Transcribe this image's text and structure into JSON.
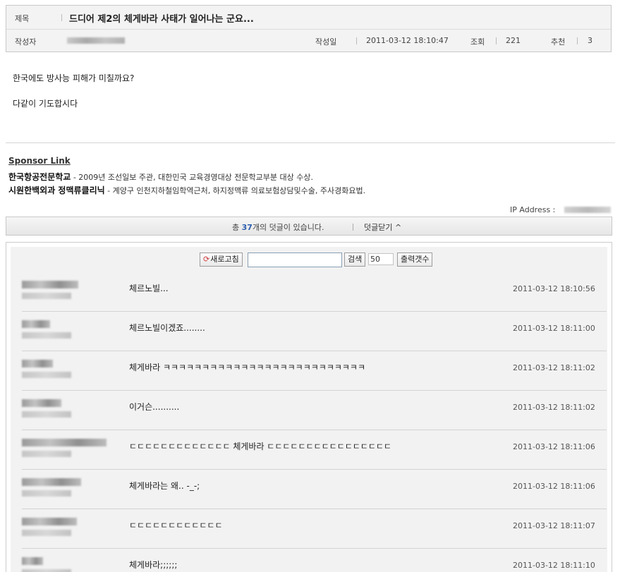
{
  "post": {
    "title_label": "제목",
    "title": "드디어 제2의 체게바라 사태가 일어나는 군요...",
    "author_label": "작성자",
    "date_label": "작성일",
    "date": "2011-03-12 18:10:47",
    "views_label": "조회",
    "views": "221",
    "recommend_label": "추천",
    "recommend": "3",
    "body_lines": [
      "한국에도 방사능 피해가 미칠까요?",
      "다같이 기도합시다"
    ]
  },
  "sponsor": {
    "title": "Sponsor Link",
    "items": [
      {
        "name": "한국항공전문학교",
        "desc": " - 2009년 조선일보 주관, 대한민국 교육경영대상 전문학교부분 대상 수상."
      },
      {
        "name": "시원한백외과 정맥류클리닉",
        "desc": " - 계양구 인천지하철임학역근처, 하지정맥류 의료보험상담및수술, 주사경화요법."
      }
    ]
  },
  "ip_label": "IP Address :",
  "comment_bar": {
    "prefix": "총 ",
    "count": "37",
    "suffix": "개의 덧글이 있습니다.",
    "toggle": "덧글닫기 ^"
  },
  "toolbar": {
    "refresh_label": "새로고침",
    "search_placeholder": "",
    "search_label": "검색",
    "count_value": "50",
    "output_label": "출력갯수"
  },
  "comments": [
    {
      "text": "체르노빌...",
      "date": "2011-03-12 18:10:56"
    },
    {
      "text": "체르노빌이겠죠........",
      "date": "2011-03-12 18:11:00"
    },
    {
      "text": "체게바라 ㅋㅋㅋㅋㅋㅋㅋㅋㅋㅋㅋㅋㅋㅋㅋㅋㅋㅋㅋㅋㅋㅋㅋㅋㅋㅋ",
      "date": "2011-03-12 18:11:02"
    },
    {
      "text": "이거슨..........",
      "date": "2011-03-12 18:11:02"
    },
    {
      "text": "ㄷㄷㄷㄷㄷㄷㄷㄷㄷㄷㄷㄷㄷ 체게바라 ㄷㄷㄷㄷㄷㄷㄷㄷㄷㄷㄷㄷㄷㄷㄷㄷ",
      "date": "2011-03-12 18:11:06"
    },
    {
      "text": "체게바라는 왜.. -_-;",
      "date": "2011-03-12 18:11:06"
    },
    {
      "text": "ㄷㄷㄷㄷㄷㄷㄷㄷㄷㄷㄷㄷ",
      "date": "2011-03-12 18:11:07"
    },
    {
      "text": "체게바라;;;;;;",
      "date": "2011-03-12 18:11:10"
    }
  ],
  "colors": {
    "accent": "#2e5fad",
    "header_bg": "#f3f3f3",
    "comment_bg": "#f2f2f2"
  }
}
